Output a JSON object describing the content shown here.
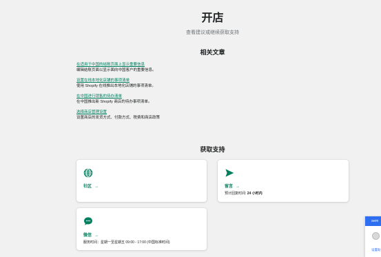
{
  "header": {
    "title": "开店",
    "subtitle": "查看建议或继续获取支持"
  },
  "related": {
    "heading": "相关文章",
    "articles": [
      {
        "link": "在适用于中国的结账页面上显示重要信息",
        "desc": "编辑结账页面以显示面向中国客户的重要信息。"
      },
      {
        "link": "设置在线本地化店铺的事项清单",
        "desc": "使用 Shopify 在线推出本地化店铺的事项清单。"
      },
      {
        "link": "在中国进行销售的待办清单",
        "desc": "在中国推出新 Shopify 商店的待办事项清单。"
      },
      {
        "link": "选择商店管理设置",
        "desc": "设置商店的发货方式、付款方式、税费和商店政策"
      }
    ]
  },
  "support": {
    "heading": "获取支持",
    "arrow": "→",
    "community": {
      "title": "社区"
    },
    "message": {
      "title": "留言",
      "sub_prefix": "预计回复时间:",
      "sub_value": "24 小时内"
    },
    "wechat": {
      "title": "微信",
      "sub": "服务时间：星期一至星期五 09:00 - 17:00 (中国标准时间)"
    }
  },
  "chat_widget": {
    "header": "sem",
    "link": "设置助"
  },
  "colors": {
    "accent": "#007f5f",
    "background": "#f1f1f1",
    "card": "#ffffff",
    "chat_blue": "#2e6ff2"
  },
  "icons": {
    "community": "globe-icon",
    "message": "send-arrow-icon",
    "wechat": "chat-bubble-icon"
  }
}
